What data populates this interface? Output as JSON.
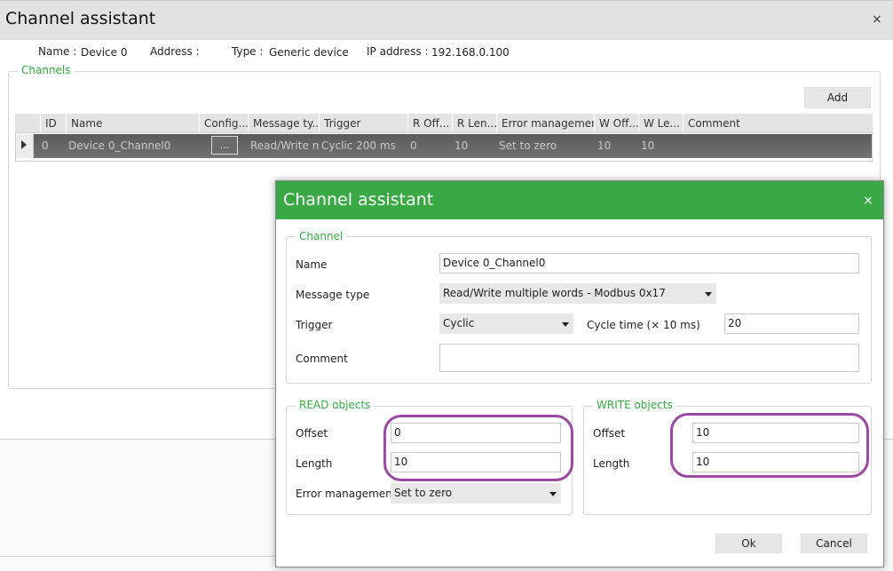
{
  "background_window": {
    "title": "Channel assistant",
    "close_glyph": "×",
    "info": {
      "name_label": "Name :",
      "name_value": "Device 0",
      "address_label": "Address :",
      "address_value": "",
      "type_label": "Type :",
      "type_value": "Generic device",
      "ip_label": "IP address :",
      "ip_value": "192.168.0.100"
    },
    "channels_legend": "Channels",
    "add_label": "Add",
    "table": {
      "columns": [
        "ID",
        "Name",
        "Config...",
        "Message ty...",
        "Trigger",
        "R Off...",
        "R Len...",
        "Error management",
        "W Off...",
        "W Le...",
        "Comment"
      ],
      "rows": [
        {
          "id": "0",
          "name": "Device 0_Channel0",
          "config": "...",
          "message_type": "Read/Write mu",
          "trigger": "Cyclic 200 ms",
          "r_offset": "0",
          "r_length": "10",
          "error_management": "Set to zero",
          "w_offset": "10",
          "w_length": "10",
          "comment": ""
        }
      ]
    }
  },
  "dialog": {
    "title": "Channel assistant",
    "close_glyph": "×",
    "accent_color": "#3aa845",
    "highlight_color": "#9b4aa3",
    "channel": {
      "legend": "Channel",
      "name_label": "Name",
      "name_value": "Device 0_Channel0",
      "message_type_label": "Message type",
      "message_type_value": "Read/Write multiple words - Modbus 0x17",
      "trigger_label": "Trigger",
      "trigger_value": "Cyclic",
      "cycle_time_label": "Cycle time (× 10 ms)",
      "cycle_time_value": "20",
      "comment_label": "Comment",
      "comment_value": ""
    },
    "read_objects": {
      "legend": "READ objects",
      "offset_label": "Offset",
      "offset_value": "0",
      "length_label": "Length",
      "length_value": "10",
      "error_label": "Error management",
      "error_value": "Set to zero"
    },
    "write_objects": {
      "legend": "WRITE objects",
      "offset_label": "Offset",
      "offset_value": "10",
      "length_label": "Length",
      "length_value": "10"
    },
    "ok_label": "Ok",
    "cancel_label": "Cancel"
  }
}
